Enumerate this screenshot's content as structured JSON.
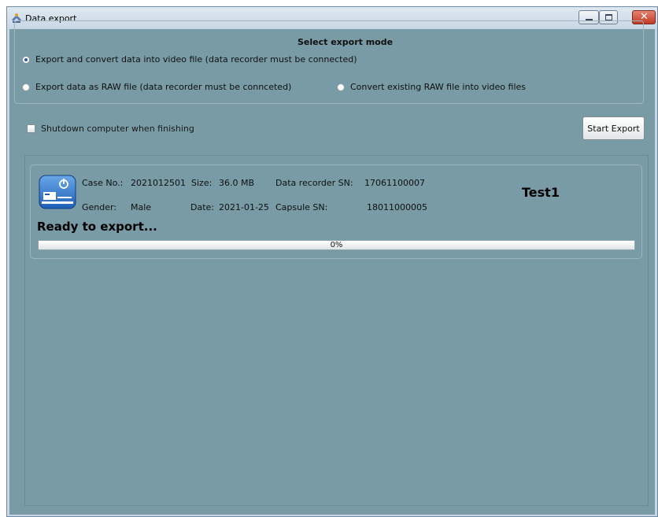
{
  "window": {
    "title": "Data export"
  },
  "mode_group": {
    "legend": "Select export mode",
    "options": [
      {
        "label": "Export and convert data into video file (data recorder must be connected)",
        "checked": true
      },
      {
        "label": "Export data as RAW file (data recorder must be connceted)",
        "checked": false
      },
      {
        "label": "Convert existing RAW file into video files",
        "checked": false
      }
    ]
  },
  "shutdown": {
    "label": "Shutdown computer when finishing",
    "checked": false
  },
  "start_button": {
    "label": "Start Export"
  },
  "record": {
    "case_label": "Case No.:",
    "case_value": "2021012501",
    "size_label": "Size:",
    "size_value": "36.0 MB",
    "recorder_sn_label": "Data recorder SN:",
    "recorder_sn_value": "17061100007",
    "gender_label": "Gender:",
    "gender_value": "Male",
    "date_label": "Date:",
    "date_value": "2021-01-25",
    "capsule_sn_label": "Capsule SN:",
    "capsule_sn_value": "18011000005",
    "name": "Test1",
    "status": "Ready to export...",
    "progress_text": "0%",
    "progress_value": 0
  },
  "colors": {
    "client_bg": "#789ba5",
    "titlebar": "#c9d7e5",
    "close_button": "#c13b26"
  },
  "icons": {
    "app": "data-export-icon",
    "device": "device-export-icon"
  }
}
